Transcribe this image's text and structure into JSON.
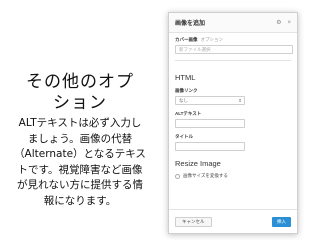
{
  "slide": {
    "title_line1": "その他のオプ",
    "title_line2": "ション",
    "body_lines": [
      "ALTテキストは必ず入力し",
      "ましょう。画像の代替",
      "（Alternate）となるテキス",
      "トです。視覚障害など画像",
      "が見れない方に提供する情",
      "報になります。"
    ]
  },
  "modal": {
    "title": "画像を追加",
    "header_icons": [
      "settings-icon",
      "close-icon"
    ],
    "header_glyphs": {
      "settings": "⚙",
      "close": "×"
    },
    "cover_image": {
      "label": "カバー画像",
      "optional": "オプション",
      "placeholder": "新ファイル選択"
    },
    "html_section": "HTML",
    "image_link": {
      "label": "画像リンク",
      "value": "なし"
    },
    "alt_text": {
      "label": "ALTテキスト",
      "value": ""
    },
    "title_field": {
      "label": "タイトル",
      "value": ""
    },
    "resize_section": "Resize Image",
    "resize_option": "画像サイズを変換する",
    "cancel_label": "キャンセル",
    "insert_label": "挿入"
  }
}
